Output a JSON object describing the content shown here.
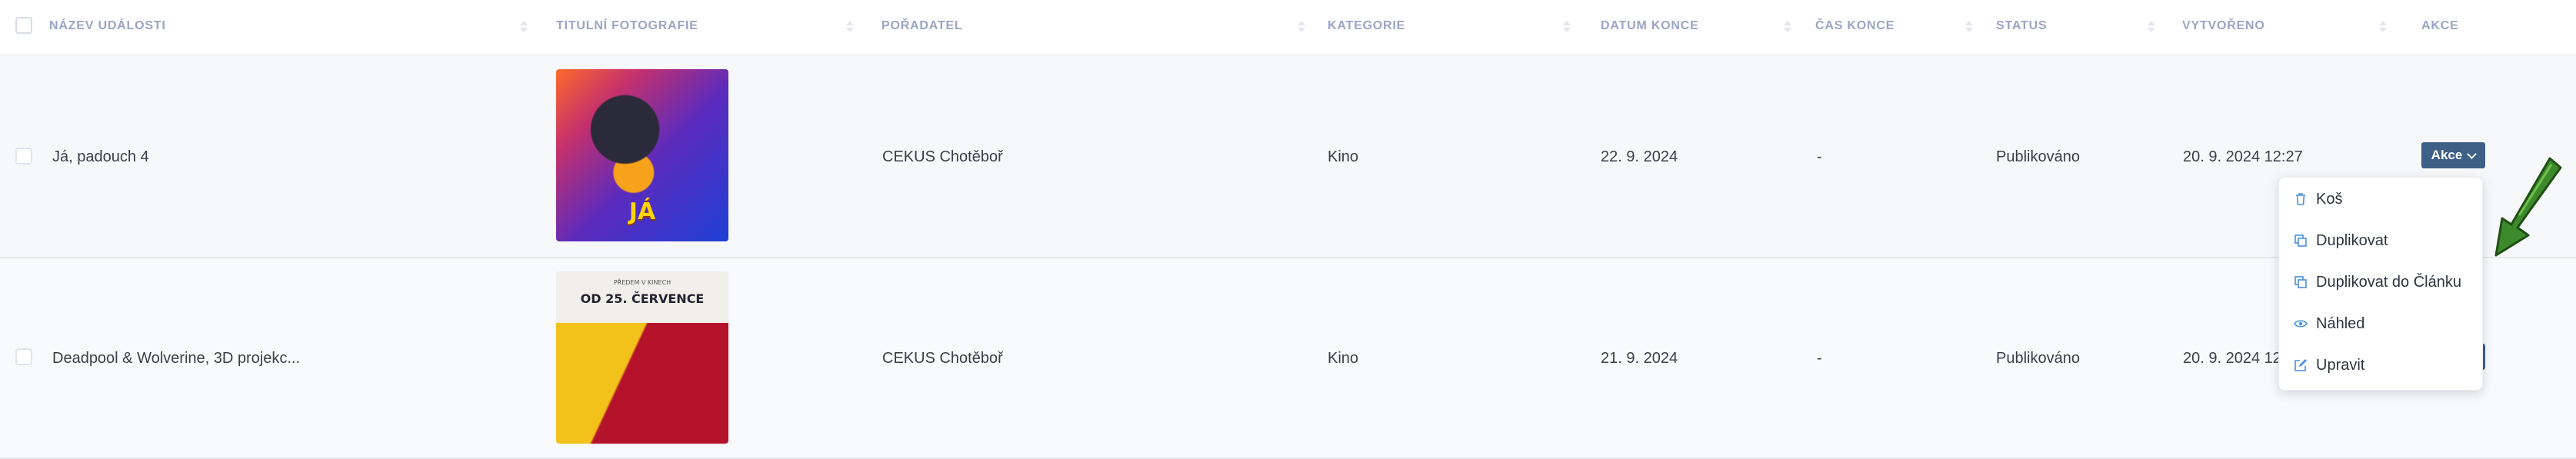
{
  "table": {
    "headers": {
      "name": "NÁZEV UDÁLOSTI",
      "photo": "TITULNÍ FOTOGRAFIE",
      "organizer": "POŘADATEL",
      "category": "KATEGORIE",
      "end_date": "DATUM KONCE",
      "end_time": "ČAS KONCE",
      "status": "STATUS",
      "created": "VYTVOŘENO",
      "actions": "AKCE"
    },
    "rows": [
      {
        "name": "Já, padouch 4",
        "poster_text": "JÁ",
        "organizer": "CEKUS Chotěboř",
        "category": "Kino",
        "end_date": "22. 9. 2024",
        "end_time": "-",
        "status": "Publikováno",
        "created": "20. 9. 2024 12:27"
      },
      {
        "name": "Deadpool & Wolverine, 3D projekc...",
        "poster_small": "PŘEDEM V KINECH",
        "poster_text": "OD 25. ČERVENCE",
        "organizer": "CEKUS Chotěboř",
        "category": "Kino",
        "end_date": "21. 9. 2024",
        "end_time": "-",
        "status": "Publikováno",
        "created": "20. 9. 2024 12"
      }
    ]
  },
  "actions_button": {
    "label": "Akce"
  },
  "dropdown": {
    "items": [
      {
        "label": "Koš",
        "icon": "trash-icon"
      },
      {
        "label": "Duplikovat",
        "icon": "copy-icon"
      },
      {
        "label": "Duplikovat do Článku",
        "icon": "copy-icon"
      },
      {
        "label": "Náhled",
        "icon": "eye-icon"
      },
      {
        "label": "Upravit",
        "icon": "edit-icon"
      }
    ]
  },
  "colors": {
    "header_text": "#9aa5c4",
    "button_bg": "#3e5f86",
    "menu_icon": "#4a90d9",
    "arrow": "#2f6d1f"
  }
}
